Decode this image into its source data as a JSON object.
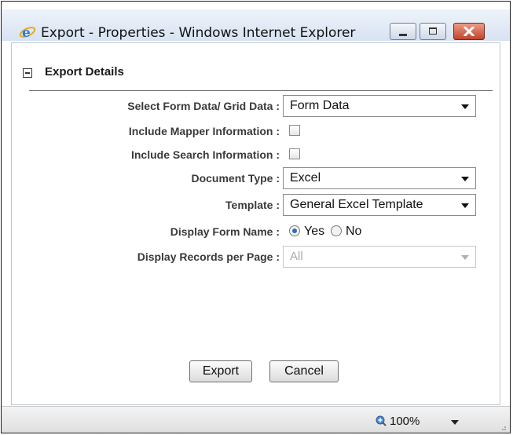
{
  "window": {
    "title": "Export - Properties - Windows Internet Explorer"
  },
  "section": {
    "title": "Export Details"
  },
  "fields": {
    "select_form_grid": {
      "label": "Select Form Data/ Grid Data :",
      "value": "Form Data"
    },
    "include_mapper": {
      "label": "Include Mapper Information :",
      "checked": false
    },
    "include_search": {
      "label": "Include Search Information :",
      "checked": false
    },
    "document_type": {
      "label": "Document Type :",
      "value": "Excel"
    },
    "template": {
      "label": "Template :",
      "value": "General Excel Template"
    },
    "display_form_name": {
      "label": "Display Form Name :",
      "options": [
        "Yes",
        "No"
      ],
      "selected": "Yes"
    },
    "display_records": {
      "label": "Display Records per Page :",
      "value": "All",
      "disabled": true
    }
  },
  "buttons": {
    "export": "Export",
    "cancel": "Cancel"
  },
  "status": {
    "zoom": "100%"
  },
  "icons": {
    "browser": "internet-explorer-icon",
    "minimize": "minimize-icon",
    "maximize": "maximize-icon",
    "close": "close-icon",
    "collapse": "collapse-icon",
    "zoom": "zoom-icon"
  },
  "colors": {
    "close_button": "#c1442a",
    "radio_selected": "#2b6fbf",
    "titlebar": "#d7e3f2"
  }
}
